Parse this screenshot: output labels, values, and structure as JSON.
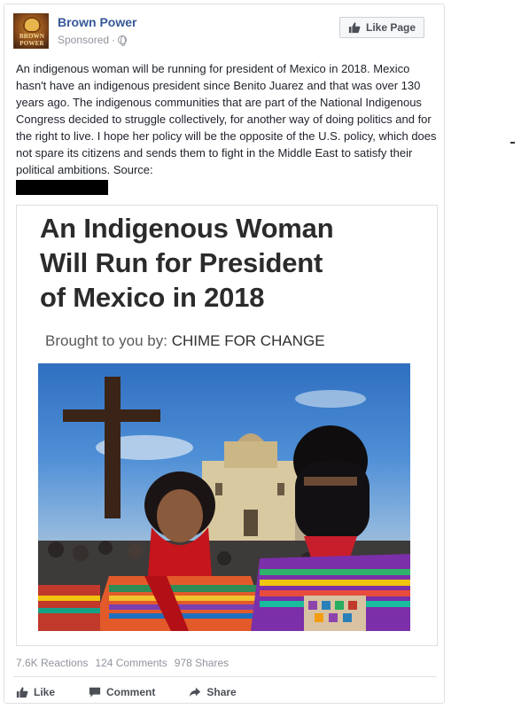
{
  "post": {
    "page_name": "Brown Power",
    "avatar_text": "BROWN POWER",
    "sponsored_label": "Sponsored",
    "separator": "·",
    "like_page_label": "Like Page",
    "body_text": "An indigenous woman will be running for president of Mexico in 2018. Mexico hasn't have an indigenous president since Benito Juarez and that was over 130 years ago. The indigenous communities that are part of the National Indigenous Congress decided to struggle collectively, for another way of doing politics and for the right to live. I hope her policy will be the opposite of the U.S. policy, which does not spare its citizens and sends them to fight in the Middle East to satisfy their political ambitions. Source:"
  },
  "attachment": {
    "headline_lines": [
      "An Indigenous Woman",
      "Will Run for President",
      "of Mexico in 2018"
    ],
    "byline_prefix": "Brought to you by: ",
    "byline_brand": "CHIME FOR CHANGE"
  },
  "stats": {
    "reactions": "7.6K Reactions",
    "comments": "124 Comments",
    "shares": "978 Shares"
  },
  "actions": {
    "like": "Like",
    "comment": "Comment",
    "share": "Share"
  },
  "icons": {
    "globe": "globe-icon",
    "thumb": "thumbs-up-icon",
    "comment": "speech-bubble-icon",
    "share": "share-arrow-icon"
  },
  "colors": {
    "link_blue": "#365899",
    "meta_gray": "#90949c",
    "action_gray": "#4b4f56"
  }
}
